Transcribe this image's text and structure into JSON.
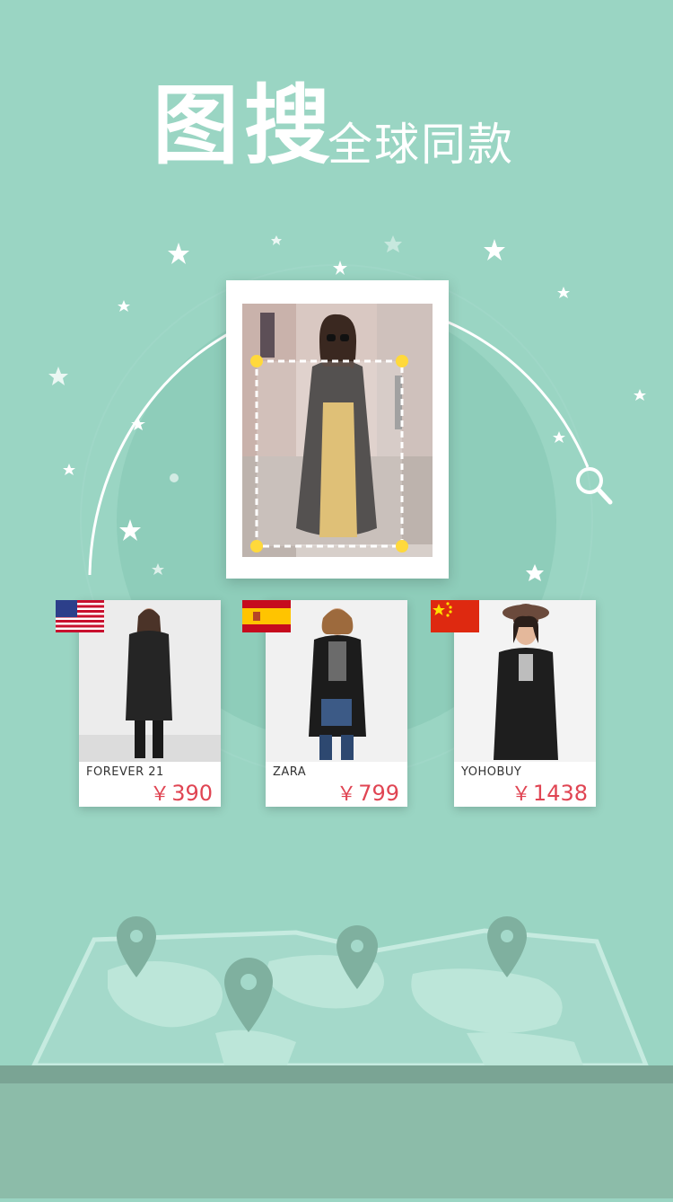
{
  "headline": {
    "main": "图搜",
    "sub": "全球同款"
  },
  "colors": {
    "background": "#9ad5c3",
    "circle": "#8ccbb8",
    "price": "#e04553",
    "scan_handle": "#ffd93b",
    "map_ground": "#7fb09f"
  },
  "source_photo": {
    "icon": "scan-frame-icon"
  },
  "search": {
    "icon": "magnifier-icon"
  },
  "results": [
    {
      "brand": "FOREVER 21",
      "price_symbol": "￥",
      "price": "390",
      "flag": "usa-flag-icon"
    },
    {
      "brand": "ZARA",
      "price_symbol": "￥",
      "price": "799",
      "flag": "spain-flag-icon"
    },
    {
      "brand": "YOHOBUY",
      "price_symbol": "￥",
      "price": "1438",
      "flag": "china-flag-icon"
    }
  ],
  "map": {
    "pins": [
      "map-pin-icon",
      "map-pin-icon",
      "map-pin-icon",
      "map-pin-icon"
    ]
  }
}
